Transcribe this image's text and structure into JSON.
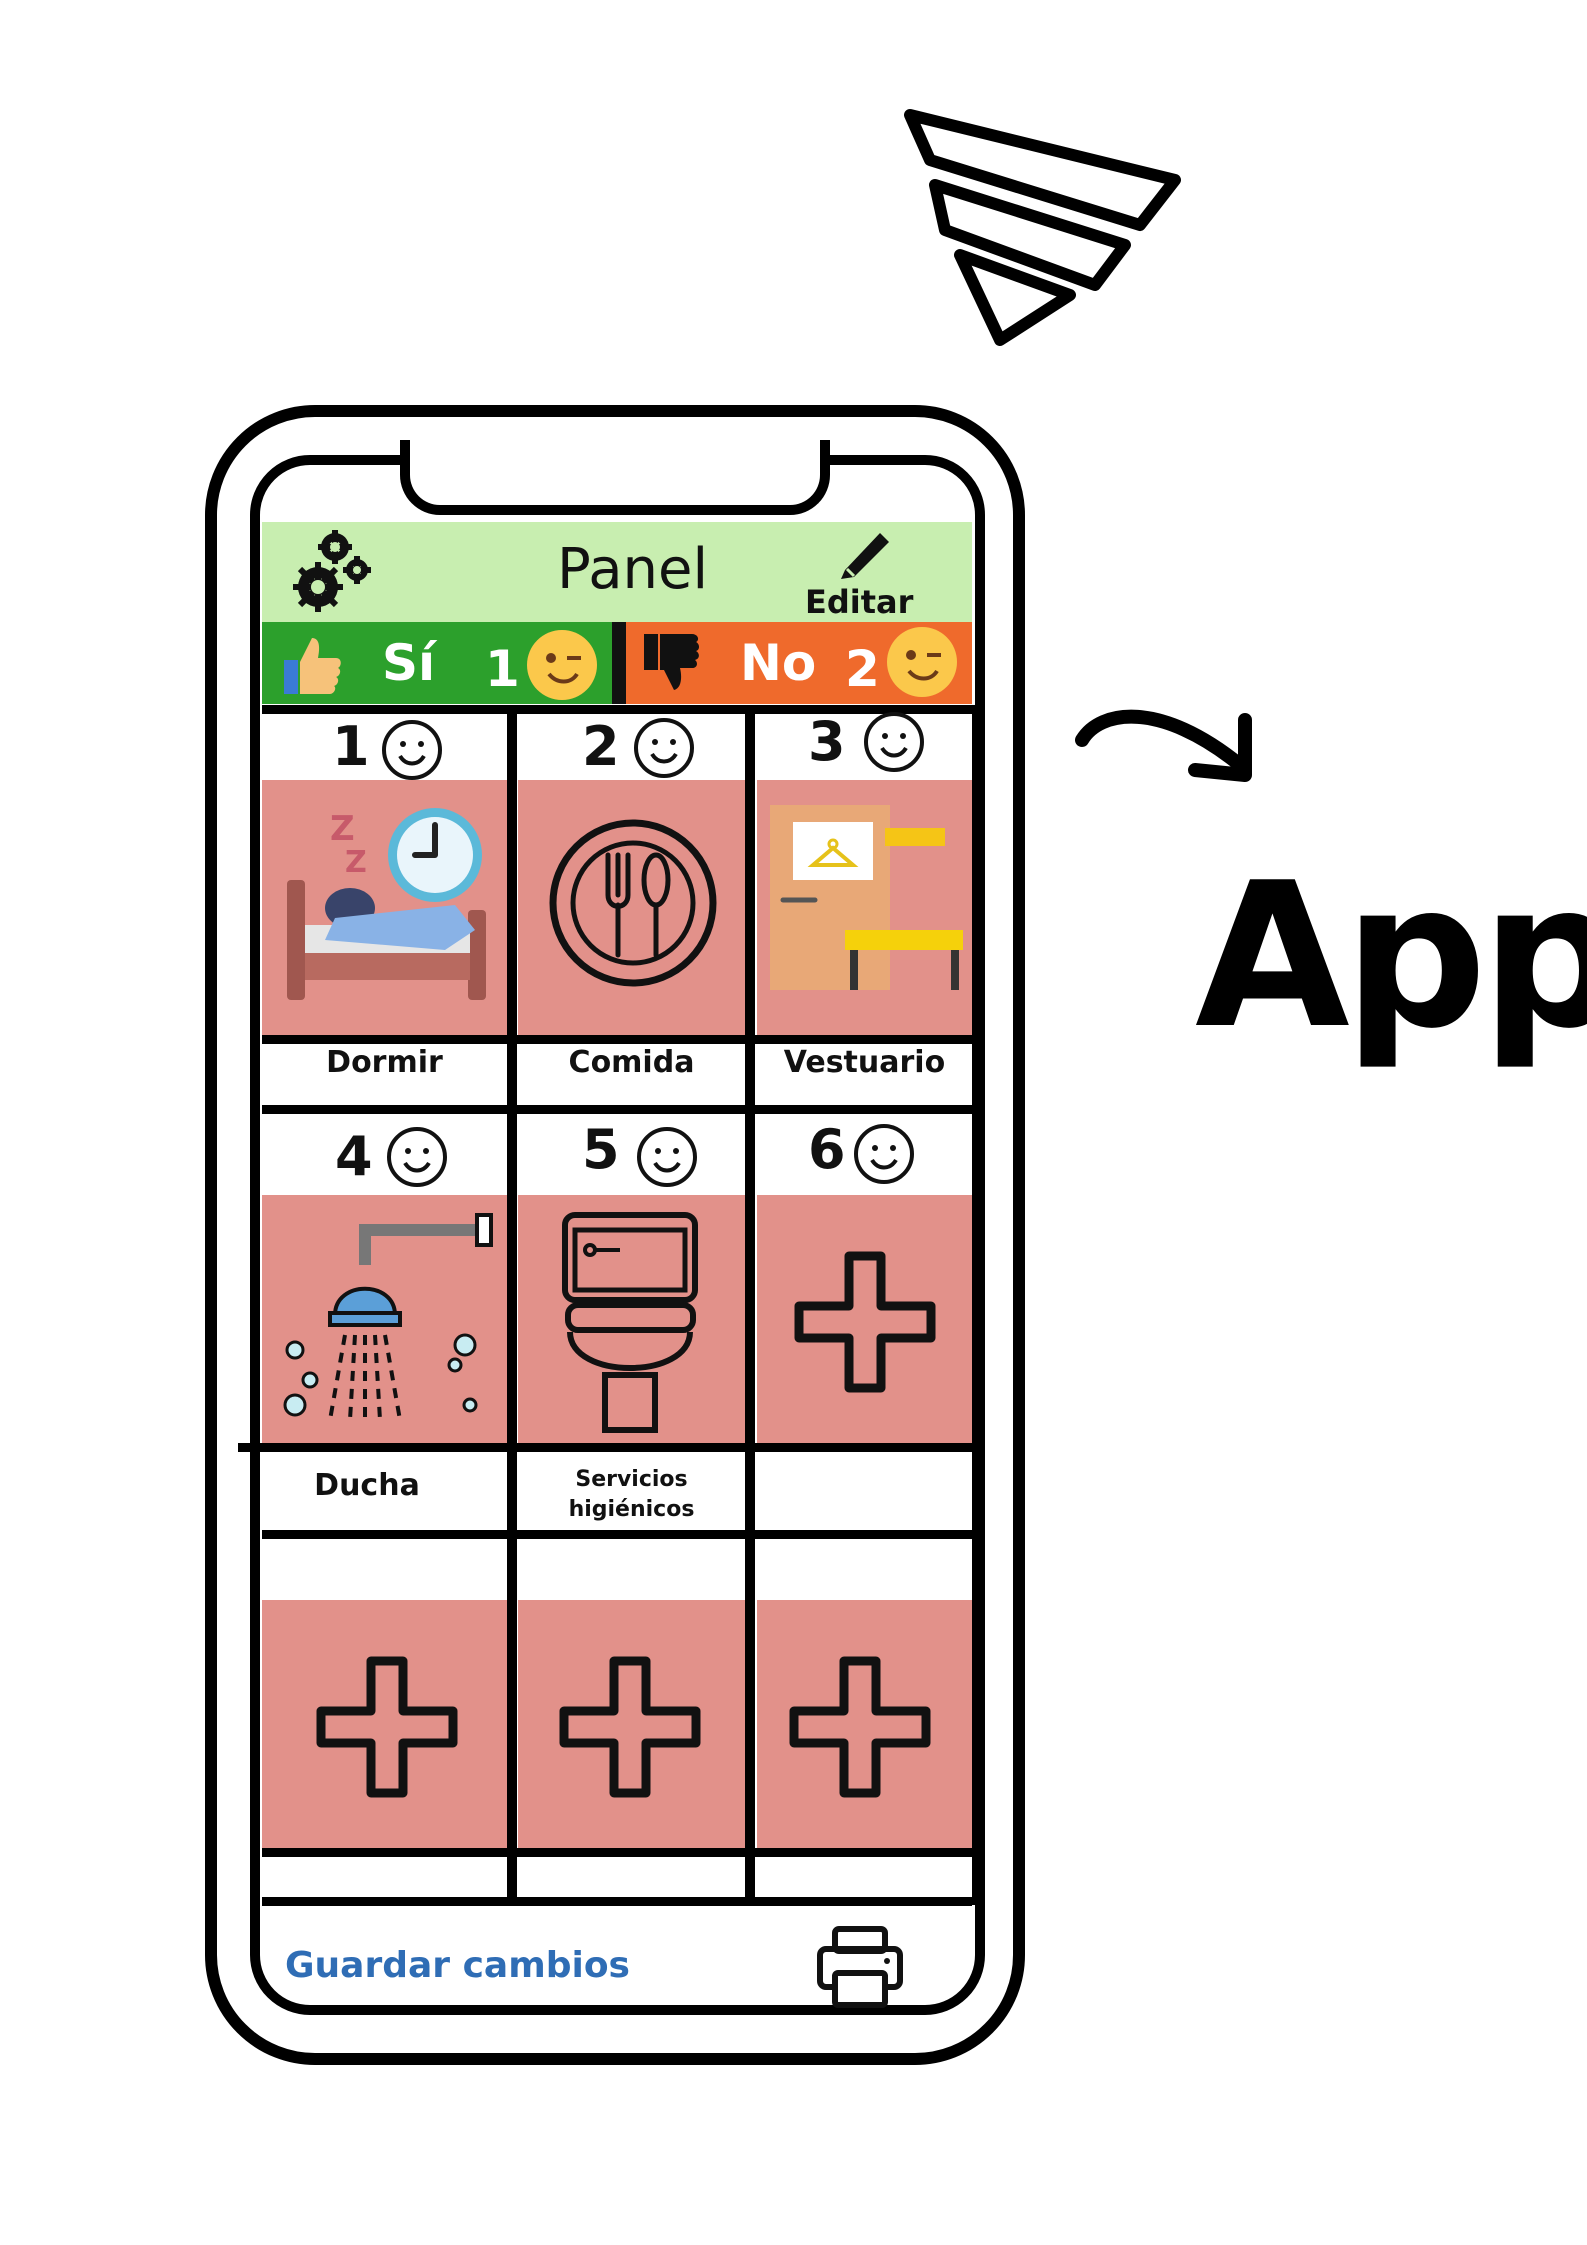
{
  "header": {
    "title": "Panel",
    "edit_label": "Editar"
  },
  "yes_no_bar": {
    "yes": {
      "label": "Sí",
      "count": "1"
    },
    "no": {
      "label": "No",
      "count": "2"
    }
  },
  "grid": {
    "items": [
      {
        "number": "1",
        "label": "Dormir",
        "icon": "sleeping-bed-clock-icon"
      },
      {
        "number": "2",
        "label": "Comida",
        "icon": "plate-fork-spoon-icon"
      },
      {
        "number": "3",
        "label": "Vestuario",
        "icon": "wardrobe-room-icon"
      },
      {
        "number": "4",
        "label": "Ducha",
        "icon": "shower-icon"
      },
      {
        "number": "5",
        "label": "Servicios higiénicos",
        "label_line1": "Servicios",
        "label_line2": "higiénicos",
        "icon": "toilet-icon"
      },
      {
        "number": "6",
        "label": "",
        "icon": "plus-icon"
      }
    ],
    "empty_row_icon": "plus-icon"
  },
  "footer": {
    "save_label": "Guardar cambios",
    "print_icon": "printer-icon"
  },
  "side": {
    "app_label": "App",
    "wifi_icon": "wifi-signal-icon",
    "arrow_icon": "curved-arrow-icon"
  },
  "colors": {
    "header_green": "#c8eeb0",
    "yes_green": "#2ca02c",
    "no_orange": "#ef6a2c",
    "tile_pink": "#e2918a",
    "save_blue": "#2f6db5"
  }
}
